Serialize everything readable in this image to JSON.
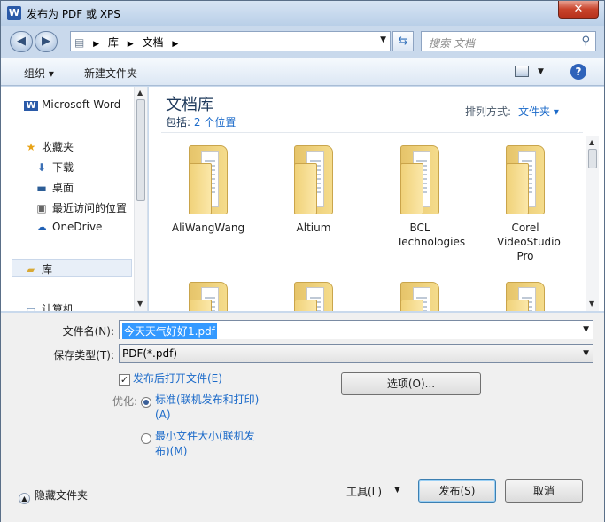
{
  "window": {
    "title": "发布为 PDF 或 XPS",
    "app_icon": "word-icon",
    "close_label": "✕"
  },
  "nav": {
    "breadcrumbs": [
      "库",
      "文档"
    ],
    "search_placeholder": "搜索 文档"
  },
  "toolbar": {
    "organize_label": "组织 ▾",
    "new_folder_label": "新建文件夹"
  },
  "sidebar": {
    "items": [
      {
        "label": "Microsoft Word",
        "icon": "word-icon"
      },
      {
        "label": "收藏夹",
        "icon": "star-icon"
      },
      {
        "label": "下载",
        "icon": "download-folder-icon"
      },
      {
        "label": "桌面",
        "icon": "desktop-icon"
      },
      {
        "label": "最近访问的位置",
        "icon": "recent-places-icon"
      },
      {
        "label": "OneDrive",
        "icon": "cloud-icon"
      },
      {
        "label": "库",
        "icon": "library-icon"
      },
      {
        "label": "计算机",
        "icon": "computer-icon"
      }
    ]
  },
  "main": {
    "title": "文档库",
    "includes_label": "包括:",
    "includes_link": "2 个位置",
    "sort_label": "排列方式:",
    "sort_value": "文件夹 ▾",
    "folders": [
      {
        "name": "AliWangWang"
      },
      {
        "name": "Altium"
      },
      {
        "name": "BCL Technologies"
      },
      {
        "name": "Corel VideoStudio Pro"
      },
      {
        "name": ""
      },
      {
        "name": ""
      },
      {
        "name": ""
      },
      {
        "name": ""
      }
    ]
  },
  "form": {
    "filename_label": "文件名(N):",
    "filename_value": "今天天气好好1.pdf",
    "filetype_label": "保存类型(T):",
    "filetype_value": "PDF(*.pdf)",
    "open_after_label": "发布后打开文件(E)",
    "open_after_checked": true,
    "optimize_label": "优化:",
    "optimize_standard": "标准(联机发布和打印)(A)",
    "optimize_minimum": "最小文件大小(联机发布)(M)",
    "options_button": "选项(O)...",
    "hide_folders": "隐藏文件夹",
    "tools_label": "工具(L)",
    "publish_button": "发布(S)",
    "cancel_button": "取消"
  }
}
